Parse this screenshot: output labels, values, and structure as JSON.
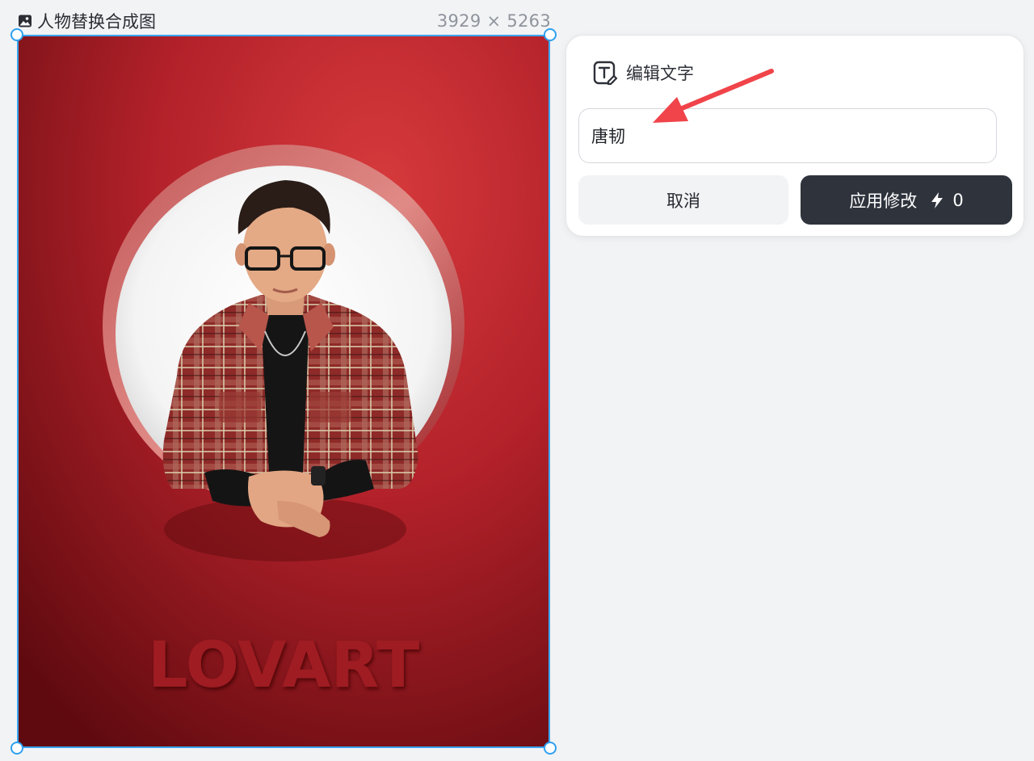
{
  "frame": {
    "title": "人物替换合成图",
    "dimensions": "3929 × 5263",
    "title_icon": "image-icon",
    "image_logo_text": "LOVART"
  },
  "edit_panel": {
    "title": "编辑文字",
    "title_icon": "text-edit-icon",
    "input_value": "唐韧",
    "cancel_label": "取消",
    "apply_label": "应用修改",
    "credit_icon": "lightning-icon",
    "credit_cost": "0"
  },
  "colors": {
    "selection": "#3aa6f0",
    "apply_button": "#2e333c",
    "annotation_arrow": "#f0444a",
    "backdrop_red": "#b5232a"
  }
}
